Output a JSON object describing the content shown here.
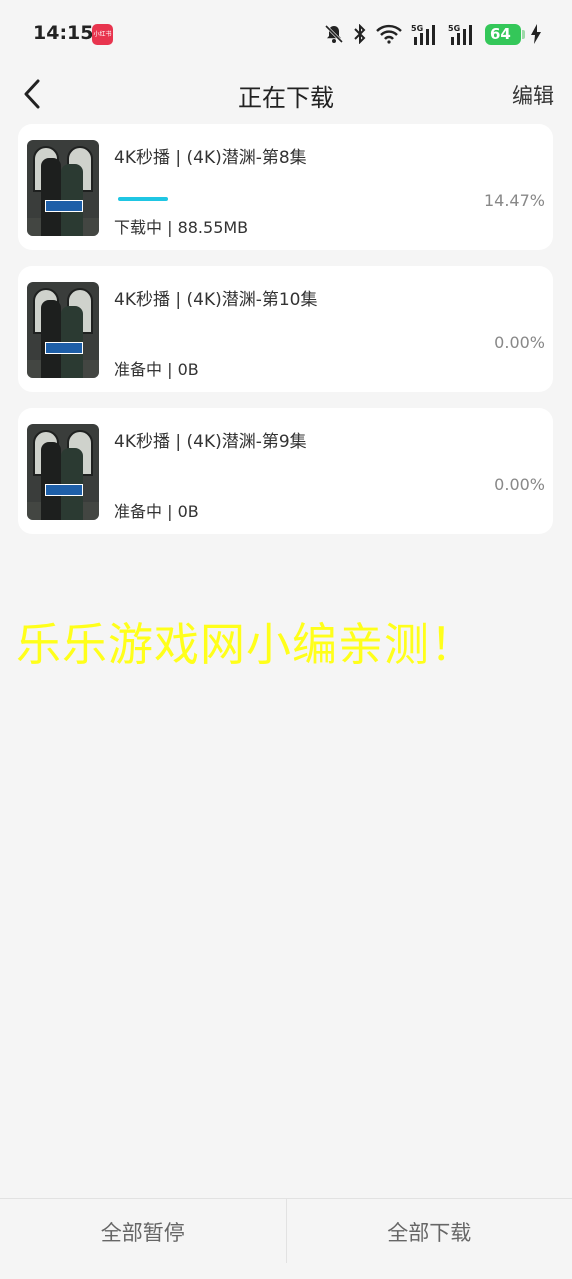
{
  "status_bar": {
    "time": "14:15",
    "app_badge_text": "小红书",
    "battery_level": "64",
    "icons": [
      "mute-bell-icon",
      "bluetooth-icon",
      "wifi-icon",
      "5g-signal-icon",
      "5g-signal-icon",
      "battery-icon",
      "charging-icon"
    ]
  },
  "header": {
    "title": "正在下载",
    "back_icon": "chevron-left-icon",
    "edit_label": "编辑"
  },
  "downloads": [
    {
      "title": "4K秒播 | (4K)潜渊-第8集",
      "status": "下载中 | 88.55MB",
      "percent": "14.47%",
      "progress": 0.1447,
      "show_bar": true
    },
    {
      "title": "4K秒播 | (4K)潜渊-第10集",
      "status": "准备中 | 0B",
      "percent": "0.00%",
      "progress": 0,
      "show_bar": false
    },
    {
      "title": "4K秒播 | (4K)潜渊-第9集",
      "status": "准备中 | 0B",
      "percent": "0.00%",
      "progress": 0,
      "show_bar": false
    }
  ],
  "watermark": "乐乐游戏网小编亲测！",
  "bottom": {
    "pause_all": "全部暂停",
    "download_all": "全部下载"
  },
  "colors": {
    "progress": "#1fc6e3",
    "watermark": "#ffff1a",
    "battery": "#34c759"
  }
}
